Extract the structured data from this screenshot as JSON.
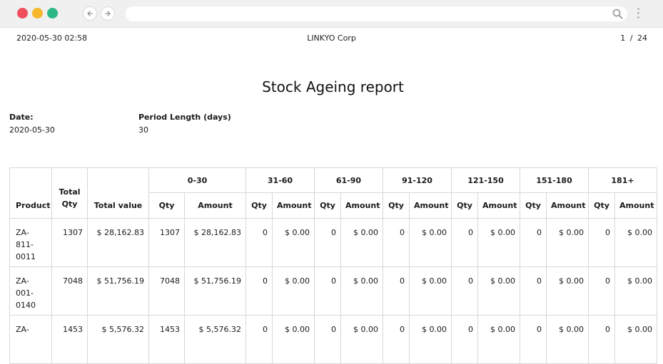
{
  "header": {
    "datetime": "2020-05-30 02:58",
    "company": "LINKYO Corp",
    "page": "1 / 24"
  },
  "report": {
    "title": "Stock Ageing report",
    "date_label": "Date:",
    "date_value": "2020-05-30",
    "period_label": "Period Length (days)",
    "period_value": "30"
  },
  "table": {
    "col_product": "Product",
    "col_total_qty": "Total Qty",
    "col_total_value": "Total value",
    "sub_qty": "Qty",
    "sub_amount": "Amount",
    "buckets": [
      "0-30",
      "31-60",
      "61-90",
      "91-120",
      "121-150",
      "151-180",
      "181+"
    ],
    "rows": [
      {
        "product": "ZA-811-0011",
        "total_qty": "1307",
        "total_value": "$ 28,162.83",
        "buckets": [
          [
            "1307",
            "$ 28,162.83"
          ],
          [
            "0",
            "$ 0.00"
          ],
          [
            "0",
            "$ 0.00"
          ],
          [
            "0",
            "$ 0.00"
          ],
          [
            "0",
            "$ 0.00"
          ],
          [
            "0",
            "$ 0.00"
          ],
          [
            "0",
            "$ 0.00"
          ]
        ]
      },
      {
        "product": "ZA-001-0140",
        "total_qty": "7048",
        "total_value": "$ 51,756.19",
        "buckets": [
          [
            "7048",
            "$ 51,756.19"
          ],
          [
            "0",
            "$ 0.00"
          ],
          [
            "0",
            "$ 0.00"
          ],
          [
            "0",
            "$ 0.00"
          ],
          [
            "0",
            "$ 0.00"
          ],
          [
            "0",
            "$ 0.00"
          ],
          [
            "0",
            "$ 0.00"
          ]
        ]
      },
      {
        "product": "ZA-",
        "total_qty": "1453",
        "total_value": "$ 5,576.32",
        "buckets": [
          [
            "1453",
            "$ 5,576.32"
          ],
          [
            "0",
            "$ 0.00"
          ],
          [
            "0",
            "$ 0.00"
          ],
          [
            "0",
            "$ 0.00"
          ],
          [
            "0",
            "$ 0.00"
          ],
          [
            "0",
            "$ 0.00"
          ],
          [
            "0",
            "$ 0.00"
          ]
        ]
      }
    ]
  },
  "icons": {
    "back": "arrow-left-icon",
    "forward": "arrow-right-icon",
    "search": "search-icon",
    "menu": "kebab-menu-icon"
  },
  "colors": {
    "close": "#ee4e5e",
    "minimize": "#f7b72b",
    "maximize": "#2bb884"
  }
}
